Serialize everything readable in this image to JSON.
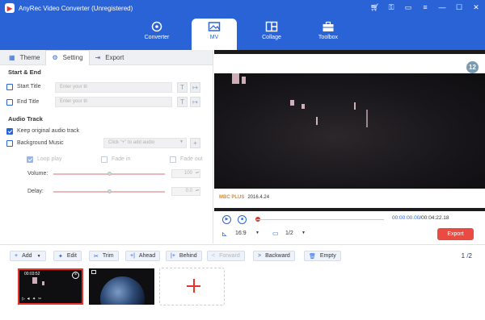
{
  "app": {
    "title": "AnyRec Video Converter (Unregistered)"
  },
  "nav": {
    "tabs": [
      {
        "label": "Converter"
      },
      {
        "label": "MV"
      },
      {
        "label": "Collage"
      },
      {
        "label": "Toolbox"
      }
    ],
    "active": "MV"
  },
  "left": {
    "tabs": [
      {
        "label": "Theme"
      },
      {
        "label": "Setting"
      },
      {
        "label": "Export"
      }
    ],
    "start_end": {
      "heading": "Start & End",
      "start_title": "Start Title",
      "end_title": "End Title",
      "placeholder": "Enter your tit"
    },
    "audio": {
      "heading": "Audio Track",
      "keep_original": "Keep original audio track",
      "background_music": "Background Music",
      "add_audio_placeholder": "Click \"+\" to add audio",
      "loop_play": "Loop play",
      "fade_in": "Fade in",
      "fade_out": "Fade out",
      "volume_label": "Volume:",
      "volume_value": "100",
      "delay_label": "Delay:",
      "delay_value": "0.0"
    }
  },
  "preview": {
    "badge": "12",
    "caption_brand": "MBC PLUS",
    "caption_date": "2016.4.24",
    "time_current": "00:00:00.00",
    "time_total": "00:04:22.18",
    "aspect": "16:9",
    "page": "1/2",
    "export_label": "Export"
  },
  "toolbar": {
    "add": "Add",
    "edit": "Edit",
    "trim": "Trim",
    "ahead": "Ahead",
    "behind": "Behind",
    "forward": "Forward",
    "backward": "Backward",
    "empty": "Empty",
    "pager_current": "1",
    "pager_total": "2"
  },
  "timeline": {
    "clip1_time": "00:03:52"
  },
  "colors": {
    "accent": "#2a63d6",
    "danger": "#e5332a",
    "export": "#e94a41"
  }
}
